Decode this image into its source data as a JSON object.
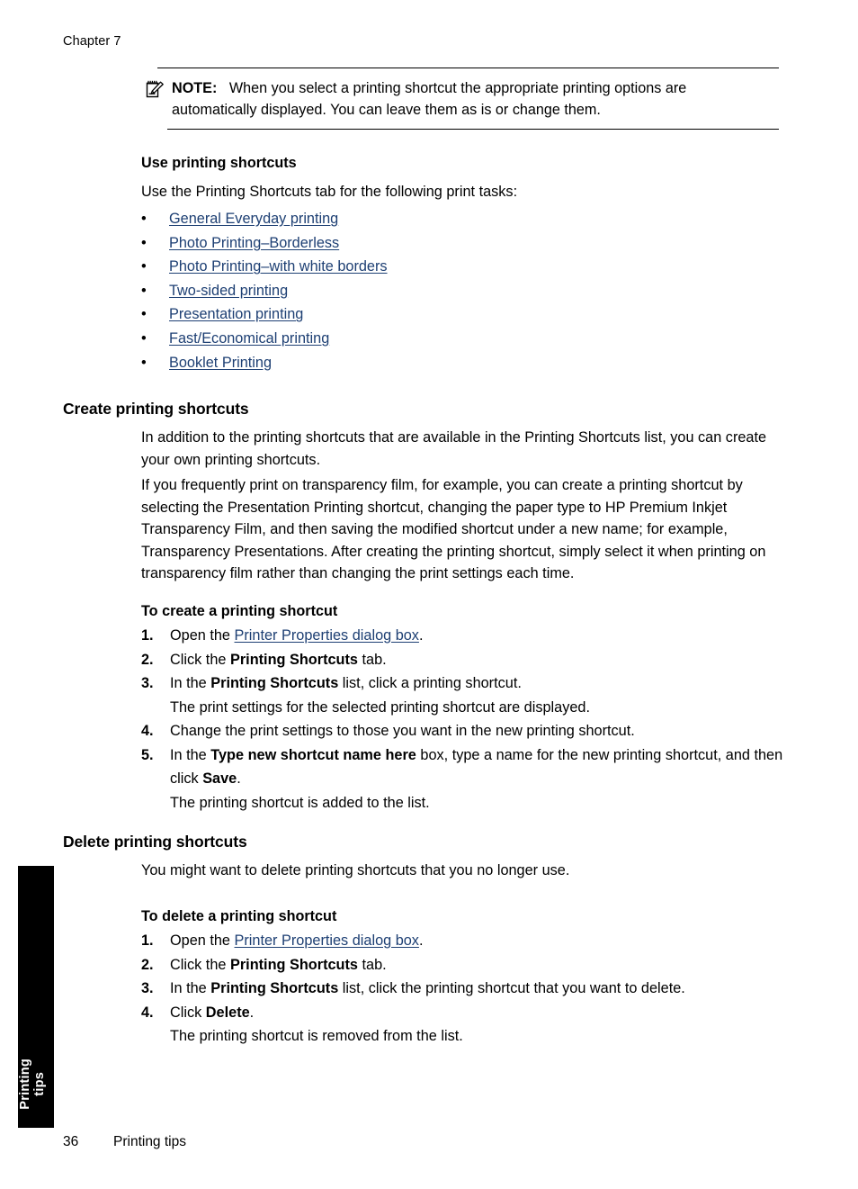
{
  "page": {
    "chapter_head": "Chapter 7",
    "footer_page_number": "36",
    "footer_title": "Printing tips",
    "side_tab_label": "Printing tips",
    "link_color": "#1d3f73"
  },
  "note": {
    "icon": "note-pad-pencil-icon",
    "label": "NOTE:",
    "text": "When you select a printing shortcut the appropriate printing options are automatically displayed. You can leave them as is or change them."
  },
  "use_shortcuts": {
    "heading": "Use printing shortcuts",
    "intro": "Use the Printing Shortcuts tab for the following print tasks:",
    "bullet": "•",
    "links": [
      "General Everyday printing",
      "Photo Printing–Borderless",
      "Photo Printing–with white borders",
      "Two-sided printing",
      "Presentation printing",
      "Fast/Economical printing",
      "Booklet Printing"
    ]
  },
  "create_shortcuts": {
    "heading": "Create printing shortcuts",
    "para1": "In addition to the printing shortcuts that are available in the Printing Shortcuts list, you can create your own printing shortcuts.",
    "para2": "If you frequently print on transparency film, for example, you can create a printing shortcut by selecting the Presentation Printing shortcut, changing the paper type to HP Premium Inkjet Transparency Film, and then saving the modified shortcut under a new name; for example, Transparency Presentations. After creating the printing shortcut, simply select it when printing on transparency film rather than changing the print settings each time.",
    "proc_heading": "To create a printing shortcut",
    "steps": [
      {
        "num": "1.",
        "pre": "Open the ",
        "link": "Printer Properties dialog box",
        "post": "."
      },
      {
        "num": "2.",
        "pre": "Click the ",
        "bold": "Printing Shortcuts",
        "post": " tab."
      },
      {
        "num": "3.",
        "pre": "In the ",
        "bold": "Printing Shortcuts",
        "post": " list, click a printing shortcut.",
        "sub": "The print settings for the selected printing shortcut are displayed."
      },
      {
        "num": "4.",
        "pre": "Change the print settings to those you want in the new printing shortcut."
      },
      {
        "num": "5.",
        "pre": "In the ",
        "bold": "Type new shortcut name here",
        "post": " box, type a name for the new printing shortcut, and then click ",
        "bold2": "Save",
        "post2": ".",
        "sub": "The printing shortcut is added to the list."
      }
    ]
  },
  "delete_shortcuts": {
    "heading": "Delete printing shortcuts",
    "para1": "You might want to delete printing shortcuts that you no longer use.",
    "proc_heading": "To delete a printing shortcut",
    "steps": [
      {
        "num": "1.",
        "pre": "Open the ",
        "link": "Printer Properties dialog box",
        "post": "."
      },
      {
        "num": "2.",
        "pre": "Click the ",
        "bold": "Printing Shortcuts",
        "post": " tab."
      },
      {
        "num": "3.",
        "pre": "In the ",
        "bold": "Printing Shortcuts",
        "post": " list, click the printing shortcut that you want to delete."
      },
      {
        "num": "4.",
        "pre": "Click ",
        "bold": "Delete",
        "post": ".",
        "sub": "The printing shortcut is removed from the list."
      }
    ]
  }
}
